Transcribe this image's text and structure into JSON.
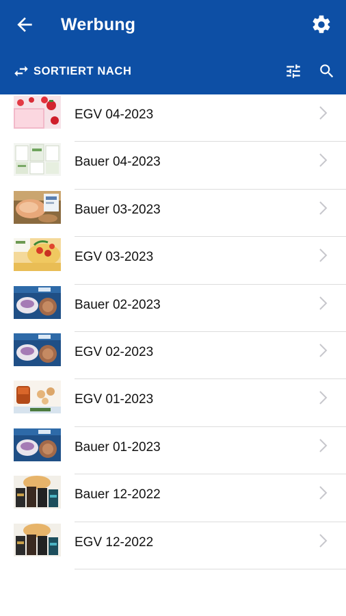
{
  "appbar": {
    "title": "Werbung",
    "back_icon": "arrow-back-icon",
    "settings_icon": "gear-icon",
    "color": "#0d4fa5"
  },
  "toolbar": {
    "sort_label": "SORTIERT NACH",
    "sort_icon": "swap-arrows-icon",
    "filter_icon": "sliders-icon",
    "search_icon": "search-icon"
  },
  "items": [
    {
      "label": "EGV 04-2023",
      "thumb": "strawberry-dessert"
    },
    {
      "label": "Bauer 04-2023",
      "thumb": "product-cards"
    },
    {
      "label": "Bauer 03-2023",
      "thumb": "seafood-dish"
    },
    {
      "label": "EGV 03-2023",
      "thumb": "pasta-tomato"
    },
    {
      "label": "Bauer 02-2023",
      "thumb": "dessert-blue"
    },
    {
      "label": "EGV 02-2023",
      "thumb": "dessert-blue"
    },
    {
      "label": "EGV 01-2023",
      "thumb": "tea-cookies"
    },
    {
      "label": "Bauer 01-2023",
      "thumb": "dessert-blue"
    },
    {
      "label": "Bauer 12-2022",
      "thumb": "dark-packages"
    },
    {
      "label": "EGV 12-2022",
      "thumb": "dark-packages"
    }
  ]
}
